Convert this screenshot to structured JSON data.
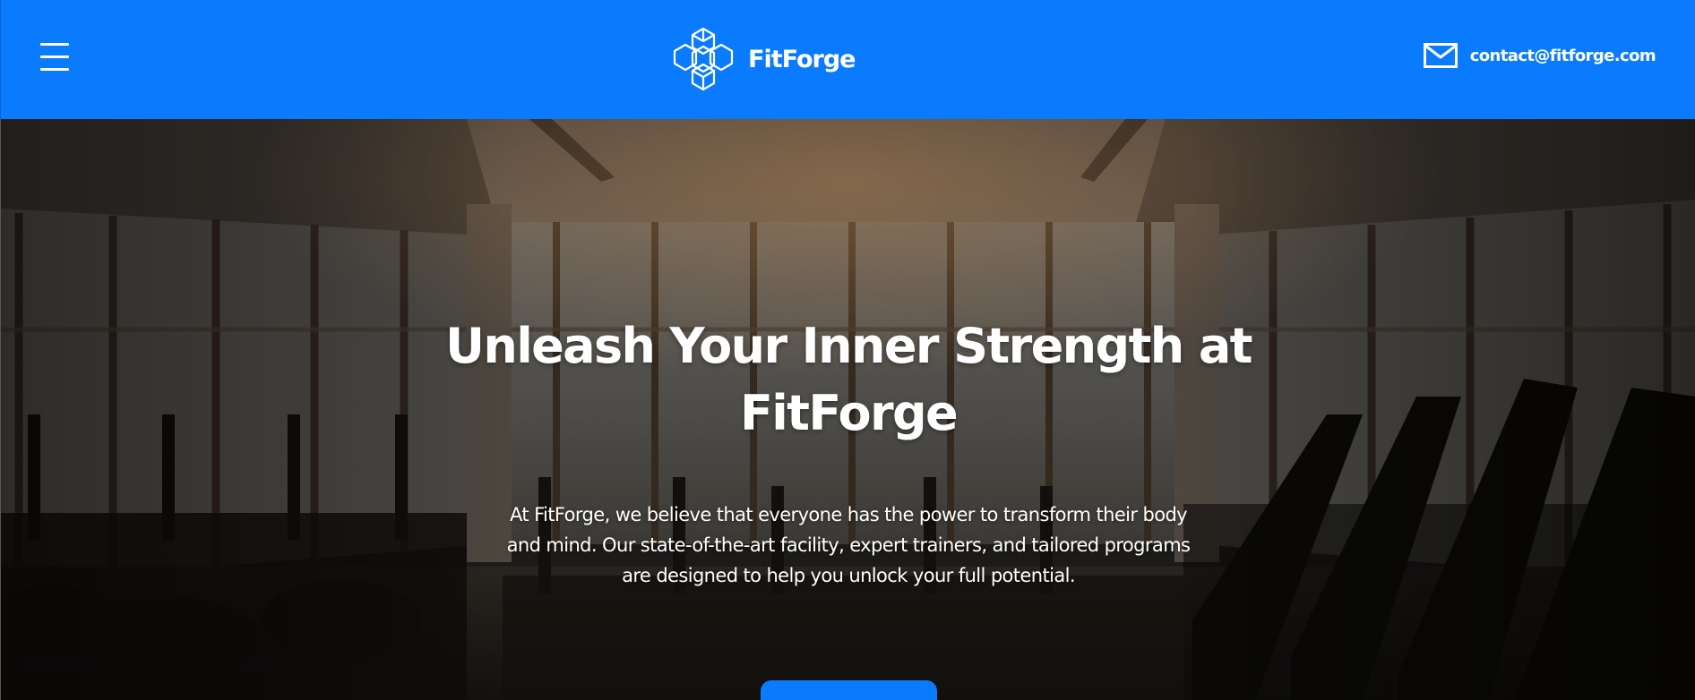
{
  "header": {
    "brand_name": "FitForge",
    "contact_email": "contact@fitforge.com",
    "icons": {
      "menu": "hamburger-menu-icon",
      "logo": "hexagon-cube-logo",
      "mail": "envelope-icon"
    },
    "colors": {
      "background": "#0a7bfc",
      "text": "#ffffff"
    }
  },
  "hero": {
    "title": "Unleash Your Inner Strength at FitForge",
    "description": "At FitForge, we believe that everyone has the power to transform their body and mind. Our state-of-the-art facility, expert trainers, and tailored programs are designed to help you unlock your full potential.",
    "background": "dark gym interior with treadmills, exercise bikes and tall windows",
    "colors": {
      "cta": "#0a7bfc",
      "text": "#ffffff"
    }
  }
}
